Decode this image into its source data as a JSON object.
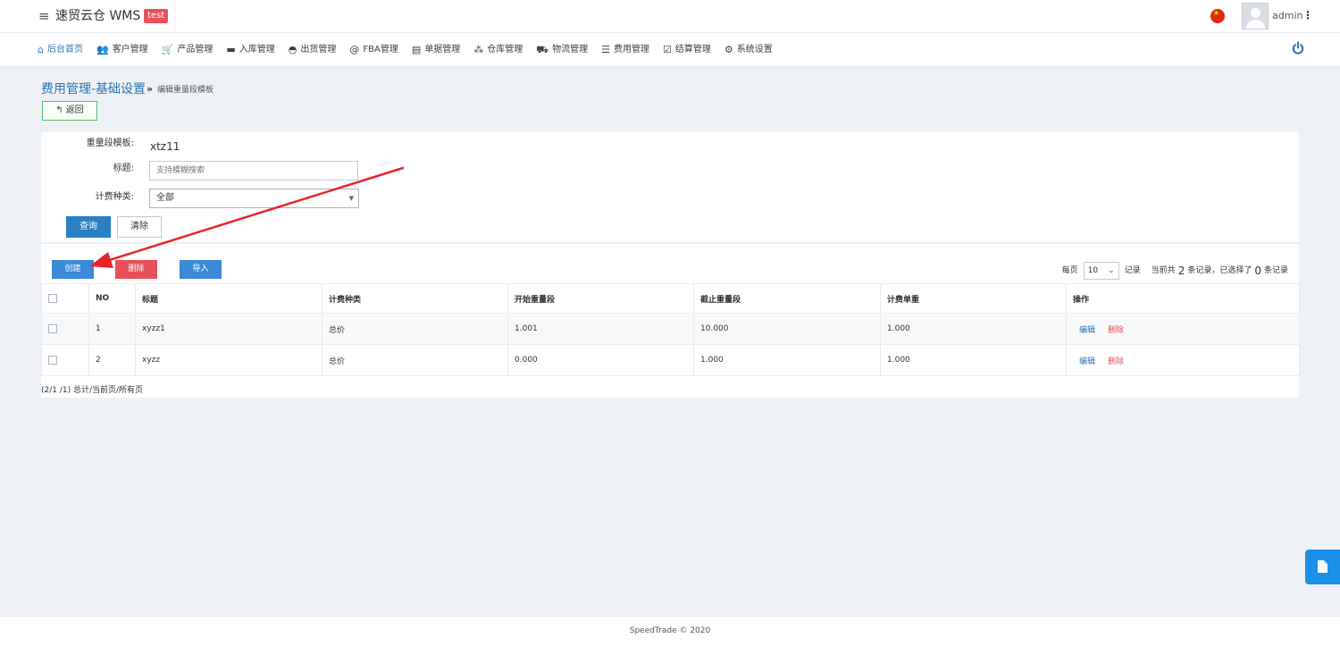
{
  "header": {
    "brand": "速贸云仓 WMS",
    "env_badge": "test",
    "user_name": "admin"
  },
  "nav": [
    {
      "label": "后台首页",
      "icon": "home-icon",
      "active": true
    },
    {
      "label": "客户管理",
      "icon": "users-icon"
    },
    {
      "label": "产品管理",
      "icon": "cart-icon"
    },
    {
      "label": "入库管理",
      "icon": "inbox-icon"
    },
    {
      "label": "出货管理",
      "icon": "tray-icon"
    },
    {
      "label": "FBA管理",
      "icon": "at-icon"
    },
    {
      "label": "单据管理",
      "icon": "document-icon"
    },
    {
      "label": "仓库管理",
      "icon": "cubes-icon"
    },
    {
      "label": "物流管理",
      "icon": "truck-icon"
    },
    {
      "label": "费用管理",
      "icon": "list-icon"
    },
    {
      "label": "结算管理",
      "icon": "check-square-icon"
    },
    {
      "label": "系统设置",
      "icon": "gear-icon"
    }
  ],
  "page": {
    "title": "费用管理-基础设置",
    "breadcrumb_sep": "»",
    "breadcrumb": "编辑重量段模板",
    "back_label": "返回"
  },
  "filter": {
    "template_label": "重量段模板:",
    "template_value": "xtz11",
    "title_label": "标题:",
    "title_placeholder": "支持模糊搜索",
    "type_label": "计费种类:",
    "type_value": "全部",
    "query_label": "查询",
    "clear_label": "清除"
  },
  "toolbar": {
    "create_label": "创建",
    "delete_label": "删除",
    "import_label": "导入"
  },
  "pager": {
    "per_page_label": "每页",
    "page_size": "10",
    "records_label": "记录",
    "total_prefix": "当前共",
    "total_count": "2",
    "total_mid": "条记录，已选择了",
    "selected_count": "0",
    "selected_suffix": "条记录"
  },
  "table": {
    "columns": [
      "NO",
      "标题",
      "计费种类",
      "开始重量段",
      "截止重量段",
      "计费单重",
      "操作"
    ],
    "rows": [
      {
        "no": "1",
        "title": "xyzz1",
        "type": "总价",
        "start": "1.001",
        "end": "10.000",
        "unit": "1.000",
        "edit": "编辑",
        "del": "删除"
      },
      {
        "no": "2",
        "title": "xyzz",
        "type": "总价",
        "start": "0.000",
        "end": "1.000",
        "unit": "1.000",
        "edit": "编辑",
        "del": "删除"
      }
    ],
    "page_info": "(2/1 /1) 总计/当前页/所有页"
  },
  "footer": {
    "text": "SpeedTrade © 2020"
  },
  "colors": {
    "primary": "#3a8ad9",
    "danger": "#e7505a",
    "success": "#4fbf6a",
    "annotation": "#e8232b"
  }
}
